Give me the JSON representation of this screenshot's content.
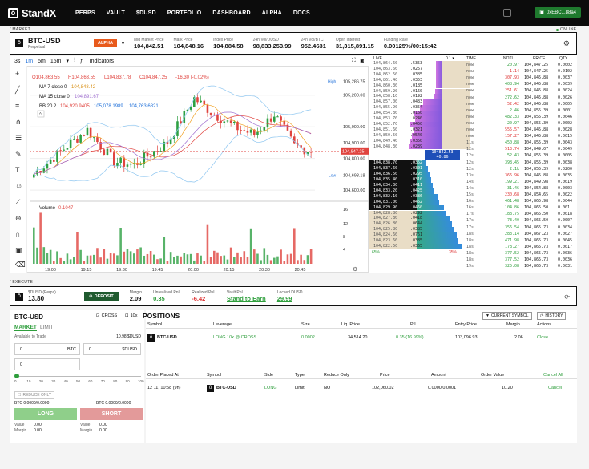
{
  "nav": {
    "logo": "StandX",
    "links": [
      "PERPS",
      "VAULT",
      "$DUSD",
      "PORTFOLIO",
      "DASHBOARD",
      "ALPHA",
      "DOCS"
    ],
    "wallet": "0xEBC...88a4"
  },
  "labels": {
    "market": "/ MARKET",
    "online": "ONLINE",
    "execute": "/ EXECUTE"
  },
  "ticker": {
    "symbol": "BTC-USD",
    "sub": "Perpetual",
    "badge": "ALPHA",
    "stats": [
      {
        "label": "Mid Market Price",
        "value": "104,842.51"
      },
      {
        "label": "Mark Price",
        "value": "104,848.16"
      },
      {
        "label": "Index Price",
        "value": "104,884.58"
      },
      {
        "label": "24h Vol/DUSD",
        "value": "98,833,253.99"
      },
      {
        "label": "24h Vol/BTC",
        "value": "952.4631"
      },
      {
        "label": "Open Interest",
        "value": "31,315,891.15"
      },
      {
        "label": "Funding Rate",
        "value": "0.00125%/00:15:42"
      }
    ]
  },
  "chart": {
    "intervals": [
      "3s",
      "1m",
      "5m",
      "15m"
    ],
    "indicators_label": "Indicators",
    "ohlc": {
      "o": "O104,863.55",
      "h": "H104,863.55",
      "l": "L104,837.78",
      "c": "C104,847.25",
      "chg": "-16.30 (-0.02%)"
    },
    "ma7": {
      "label": "MA 7 close 0",
      "value": "104,848.42"
    },
    "ma15": {
      "label": "MA 15 close 0",
      "value": "104,891.67"
    },
    "bb": {
      "label": "BB 20 2",
      "v1": "104,920.9405",
      "v2": "105,078.1989",
      "v3": "104,763.6821"
    },
    "high_label": "High",
    "high_value": "105,286.75",
    "low_label": "Low",
    "low_value": "104,693.18",
    "current_price": "104,847.25",
    "y_ticks": [
      "105,200.00",
      "105,000.00",
      "104,800.00",
      "104,600.00"
    ],
    "y_ticks_extra": "104,900.00",
    "x_ticks": [
      "19:00",
      "19:15",
      "19:30",
      "19:45",
      "20:00",
      "20:15",
      "20:30",
      "20:45"
    ],
    "volume_label": "Volume",
    "volume_value": "0.1047",
    "vol_ticks": [
      "16",
      "12",
      "8",
      "4"
    ]
  },
  "orderbook": {
    "live_label": "LIVE",
    "step": "0.1",
    "headers": [
      "TIME",
      "NOTL",
      "PRICE",
      "QTY"
    ],
    "mid": "104842.53",
    "mid_sub": "40.86",
    "asks": [
      [
        "104,864.60",
        ".5353"
      ],
      [
        "104,863.60",
        ".0257"
      ],
      [
        "104,862.50",
        ".0385"
      ],
      [
        "104,861.40",
        ".0353"
      ],
      [
        "104,860.30",
        ".0185"
      ],
      [
        "104,859.20",
        ".0160"
      ],
      [
        "104,858.10",
        ".0192"
      ],
      [
        "104,857.00",
        ".0483"
      ],
      [
        "104,855.90",
        ".0354"
      ],
      [
        "104,854.80",
        ".0160"
      ],
      [
        "104,853.70",
        ".0240"
      ],
      [
        "104,852.70",
        ".0450"
      ],
      [
        "104,851.60",
        ".0321"
      ],
      [
        "104,850.50",
        ".0540"
      ],
      [
        "104,849.40",
        ".0350"
      ],
      [
        "104,848.30",
        ".0289"
      ]
    ],
    "bids": [
      [
        "104,838.70",
        ".0352"
      ],
      [
        "104,837.60",
        ".0301"
      ],
      [
        "104,836.50",
        ".0295"
      ],
      [
        "104,835.40",
        ".0310"
      ],
      [
        "104,834.30",
        ".0411"
      ],
      [
        "104,833.20",
        ".0425"
      ],
      [
        "104,832.10",
        ".0386"
      ],
      [
        "104,831.00",
        ".0452"
      ],
      [
        "104,829.90",
        ".0460"
      ],
      [
        "104,828.80",
        ".0292"
      ],
      [
        "104,827.80",
        ".0418"
      ],
      [
        "104,826.80",
        ".0644"
      ],
      [
        "104,825.80",
        ".0385"
      ],
      [
        "104,824.60",
        ".0761"
      ],
      [
        "104,823.60",
        ".0385"
      ],
      [
        "104,822.50",
        ".0365"
      ]
    ],
    "buy_pct": "65%",
    "sell_pct": "35%",
    "trades": [
      [
        "now",
        "20.97",
        "104,847.25",
        "0.0002",
        "g"
      ],
      [
        "now",
        "1.14",
        "104,847.25",
        "0.0102",
        "r"
      ],
      [
        "now",
        "307.93",
        "104,845.88",
        "0.0037",
        "r"
      ],
      [
        "now",
        "408.94",
        "104,845.88",
        "0.0039",
        "g"
      ],
      [
        "now",
        "251.61",
        "104,845.88",
        "0.0024",
        "r"
      ],
      [
        "now",
        "272.62",
        "104,845.88",
        "0.0026",
        "g"
      ],
      [
        "now",
        "52.42",
        "104,845.88",
        "0.0005",
        "r"
      ],
      [
        "now",
        "2.46",
        "104,855.39",
        "0.0001",
        "g"
      ],
      [
        "now",
        "482.33",
        "104,855.39",
        "0.0046",
        "g"
      ],
      [
        "now",
        "20.97",
        "104,855.39",
        "0.0002",
        "g"
      ],
      [
        "now",
        "555.57",
        "104,845.88",
        "0.0028",
        "r"
      ],
      [
        "now",
        "157.27",
        "104,845.88",
        "0.0015",
        "r"
      ],
      [
        "11s",
        "450.88",
        "104,855.39",
        "0.0043",
        "g"
      ],
      [
        "12s",
        "513.74",
        "104,849.07",
        "0.0049",
        "r"
      ],
      [
        "12s",
        "52.43",
        "104,855.39",
        "0.0005",
        "g"
      ],
      [
        "12s",
        "398.45",
        "104,855.39",
        "0.0038",
        "g"
      ],
      [
        "12s",
        "2.1k",
        "104,855.39",
        "0.0200",
        "g"
      ],
      [
        "13s",
        "366.96",
        "104,845.88",
        "0.0035",
        "r"
      ],
      [
        "14s",
        "199.21",
        "104,849.98",
        "0.0019",
        "g"
      ],
      [
        "14s",
        "31.46",
        "104,854.88",
        "0.0003",
        "g"
      ],
      [
        "15s",
        "230.68",
        "104,854.65",
        "0.0022",
        "r"
      ],
      [
        "16s",
        "461.48",
        "104,865.98",
        "0.0044",
        "g"
      ],
      [
        "16s",
        "104.86",
        "104,865.50",
        "0.001",
        "g"
      ],
      [
        "17s",
        "188.75",
        "104,865.50",
        "0.0018",
        "g"
      ],
      [
        "17s",
        "73.40",
        "104,865.50",
        "0.0007",
        "g"
      ],
      [
        "17s",
        "356.54",
        "104,865.73",
        "0.0034",
        "g"
      ],
      [
        "18s",
        "283.14",
        "104,867.23",
        "0.0027",
        "g"
      ],
      [
        "18s",
        "471.98",
        "104,865.73",
        "0.0045",
        "g"
      ],
      [
        "18s",
        "178.27",
        "104,865.73",
        "0.0017",
        "g"
      ],
      [
        "18s",
        "377.52",
        "104,865.73",
        "0.0036",
        "g"
      ],
      [
        "18s",
        "377.52",
        "104,865.73",
        "0.0036",
        "g"
      ],
      [
        "19s",
        "325.08",
        "104,865.73",
        "0.0031",
        "g"
      ]
    ]
  },
  "account": {
    "currency": "$DUSD (Perps)",
    "balance": "13.80",
    "deposit": "DEPOSIT",
    "stats": [
      {
        "label": "Margin",
        "value": "2.09",
        "color": ""
      },
      {
        "label": "Unrealized PnL",
        "value": "0.35",
        "color": "g"
      },
      {
        "label": "Realized PnL",
        "value": "-6.42",
        "color": "r"
      },
      {
        "label": "Vault PnL",
        "value": "Stand to Earn",
        "color": "g"
      },
      {
        "label": "Locked DUSD",
        "value": "29.99",
        "color": "g"
      }
    ]
  },
  "order": {
    "symbol": "BTC-USD",
    "cross": "CROSS",
    "leverage": "10x",
    "tab_market": "MARKET",
    "tab_limit": "LIMIT",
    "avail_label": "Available to Trade",
    "avail_value": "10.98 $DUSD",
    "qty_value": "0",
    "qty_unit": "BTC",
    "usd_value": "0",
    "usd_unit": "$DUSD",
    "pct_value": "0",
    "slider_ticks": [
      "0",
      "10",
      "20",
      "30",
      "40",
      "50",
      "60",
      "70",
      "80",
      "90",
      "100"
    ],
    "reduce_only": "REDUCE ONLY",
    "btc_left": "BTC 0.0000/0.0000",
    "btc_right": "BTC 0.0000/0.0000",
    "long": "LONG",
    "short": "SHORT",
    "value_label": "Value",
    "margin_label": "Margin",
    "value_left": "0.00",
    "margin_left": "0.00",
    "value_right": "0.00",
    "margin_right": "0.00"
  },
  "positions": {
    "title": "POSITIONS",
    "current_symbol": "CURRENT SYMBOL",
    "history": "HISTORY",
    "headers": [
      "Symbol",
      "Leverage",
      "Size",
      "Liq. Price",
      "P/L",
      "Entry Price",
      "Margin",
      "Actions"
    ],
    "row": {
      "symbol": "BTC-USD",
      "leverage": "LONG 10x @ CROSS",
      "size": "0.0002",
      "liq": "34,514.20",
      "pl": "0.35 (16.99%)",
      "entry": "103,096.93",
      "margin": "2.06",
      "action": "Close"
    },
    "order_headers": [
      "Order Placed At",
      "Symbol",
      "Side",
      "Type",
      "Reduce Only",
      "Price",
      "Amount",
      "Order Value"
    ],
    "cancel_all": "Cancel All",
    "order_row": {
      "time": "12 11, 10:58 (9h)",
      "symbol": "BTC-USD",
      "side": "LONG",
      "type": "Limit",
      "reduce": "NO",
      "price": "102,060.02",
      "amount": "0.0000/0.0001",
      "value": "10.20",
      "action": "Cancel"
    }
  }
}
